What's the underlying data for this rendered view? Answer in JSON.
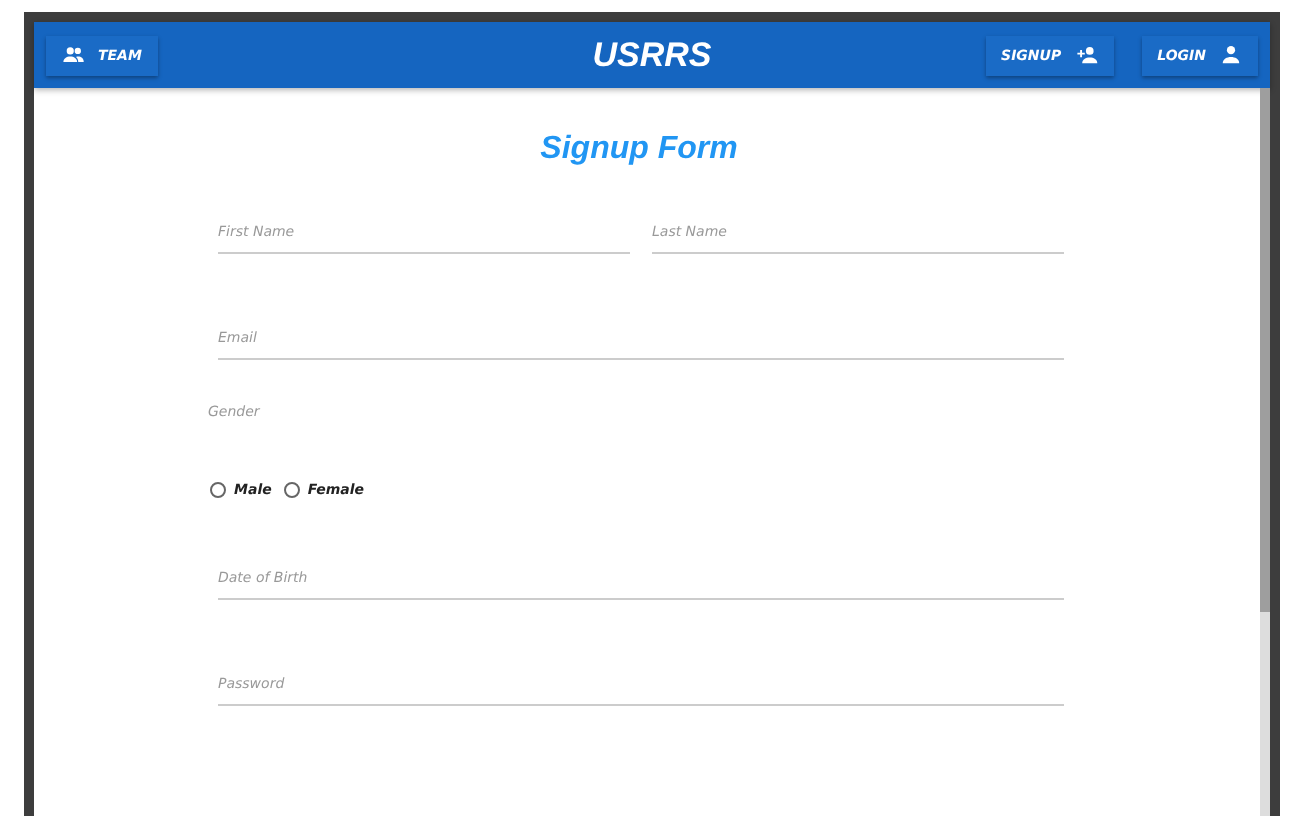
{
  "header": {
    "title": "USRRS",
    "buttons": [
      {
        "label": "TEAM",
        "kind": "group"
      },
      {
        "label": "SIGNUP",
        "kind": "add-person"
      },
      {
        "label": "LOGIN",
        "kind": "person"
      }
    ]
  },
  "form": {
    "title": "Signup Form",
    "name_fields": [
      {
        "placeholder": "First Name"
      },
      {
        "placeholder": "Last Name"
      }
    ],
    "email": {
      "placeholder": "Email"
    },
    "gender": {
      "label": "Gender",
      "options": [
        {
          "label": "Male",
          "selected": false
        },
        {
          "label": "Female",
          "selected": false
        }
      ]
    },
    "date_of_birth": {
      "placeholder": "Date of Birth"
    },
    "password": {
      "placeholder": "Password"
    }
  }
}
